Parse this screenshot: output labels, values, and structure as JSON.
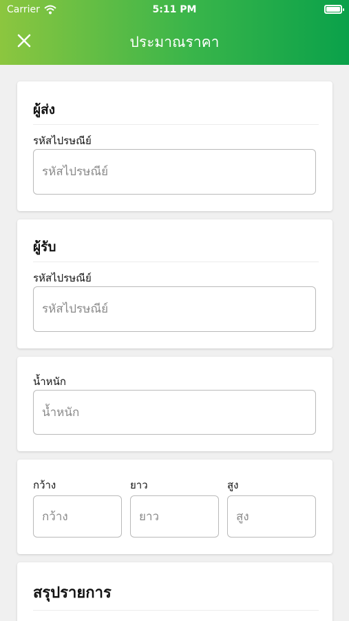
{
  "status_bar": {
    "carrier": "Carrier",
    "time": "5:11 PM"
  },
  "nav": {
    "title": "ประมาณราคา"
  },
  "sender": {
    "title": "ผู้ส่ง",
    "postcode_label": "รหัสไปรษณีย์",
    "postcode_placeholder": "รหัสไปรษณีย์"
  },
  "receiver": {
    "title": "ผู้รับ",
    "postcode_label": "รหัสไปรษณีย์",
    "postcode_placeholder": "รหัสไปรษณีย์"
  },
  "weight": {
    "label": "น้ำหนัก",
    "placeholder": "น้ำหนัก"
  },
  "dimensions": {
    "width_label": "กว้าง",
    "width_placeholder": "กว้าง",
    "length_label": "ยาว",
    "length_placeholder": "ยาว",
    "height_label": "สูง",
    "height_placeholder": "สูง"
  },
  "summary": {
    "title": "สรุปรายการ"
  },
  "colors": {
    "header_start": "#8cc63f",
    "header_end": "#0aa14a"
  },
  "icons": {
    "close": "close-icon",
    "wifi": "wifi-icon",
    "battery": "battery-icon"
  }
}
